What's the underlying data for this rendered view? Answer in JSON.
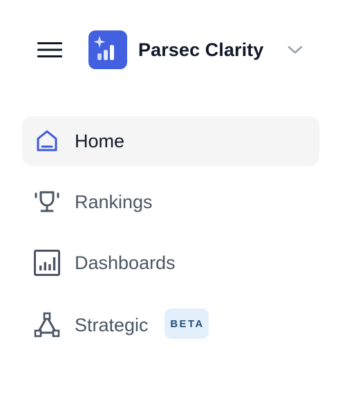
{
  "header": {
    "menu_icon": "hamburger-menu-icon",
    "logo_icon": "sparkle-bar-chart-logo",
    "app_name": "Parsec Clarity",
    "switcher_icon": "chevron-down-icon"
  },
  "nav": {
    "items": [
      {
        "label": "Home",
        "icon": "home-icon",
        "active": true
      },
      {
        "label": "Rankings",
        "icon": "trophy-icon",
        "active": false
      },
      {
        "label": "Dashboards",
        "icon": "dashboard-chart-icon",
        "active": false
      },
      {
        "label": "Strategic",
        "icon": "strategy-nodes-icon",
        "active": false,
        "badge": "BETA"
      }
    ]
  },
  "colors": {
    "brand": "#4360e0",
    "active_icon": "#3b5bdb",
    "active_bg": "#f5f5f5",
    "text_primary": "#111827",
    "text_secondary": "#4b5563",
    "badge_bg": "#e3f0fc",
    "badge_text": "#24507a"
  }
}
